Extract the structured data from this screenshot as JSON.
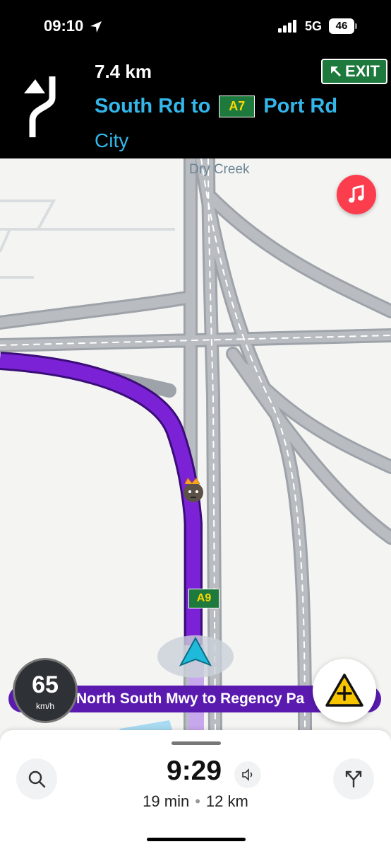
{
  "status_bar": {
    "time": "09:10",
    "network": "5G",
    "battery": "46"
  },
  "navigation": {
    "distance": "7.4 km",
    "street_from": "South Rd to",
    "route_number": "A7",
    "street_to": "Port Rd",
    "city": "City",
    "exit_label": "EXIT"
  },
  "map": {
    "poi_label": "Dry Creek",
    "road_shield": "A9",
    "route_color": "#7b22d6",
    "music_app": "music-icon"
  },
  "speed": {
    "value": "65",
    "unit": "km/h"
  },
  "current_street": "North South Mwy to Regency Pa",
  "trip": {
    "arrival_time": "9:29",
    "duration": "19 min",
    "distance": "12 km"
  },
  "colors": {
    "accent_blue": "#33b7ea",
    "shield_green": "#1e7a3c",
    "banner_purple": "#5a1ab0"
  }
}
